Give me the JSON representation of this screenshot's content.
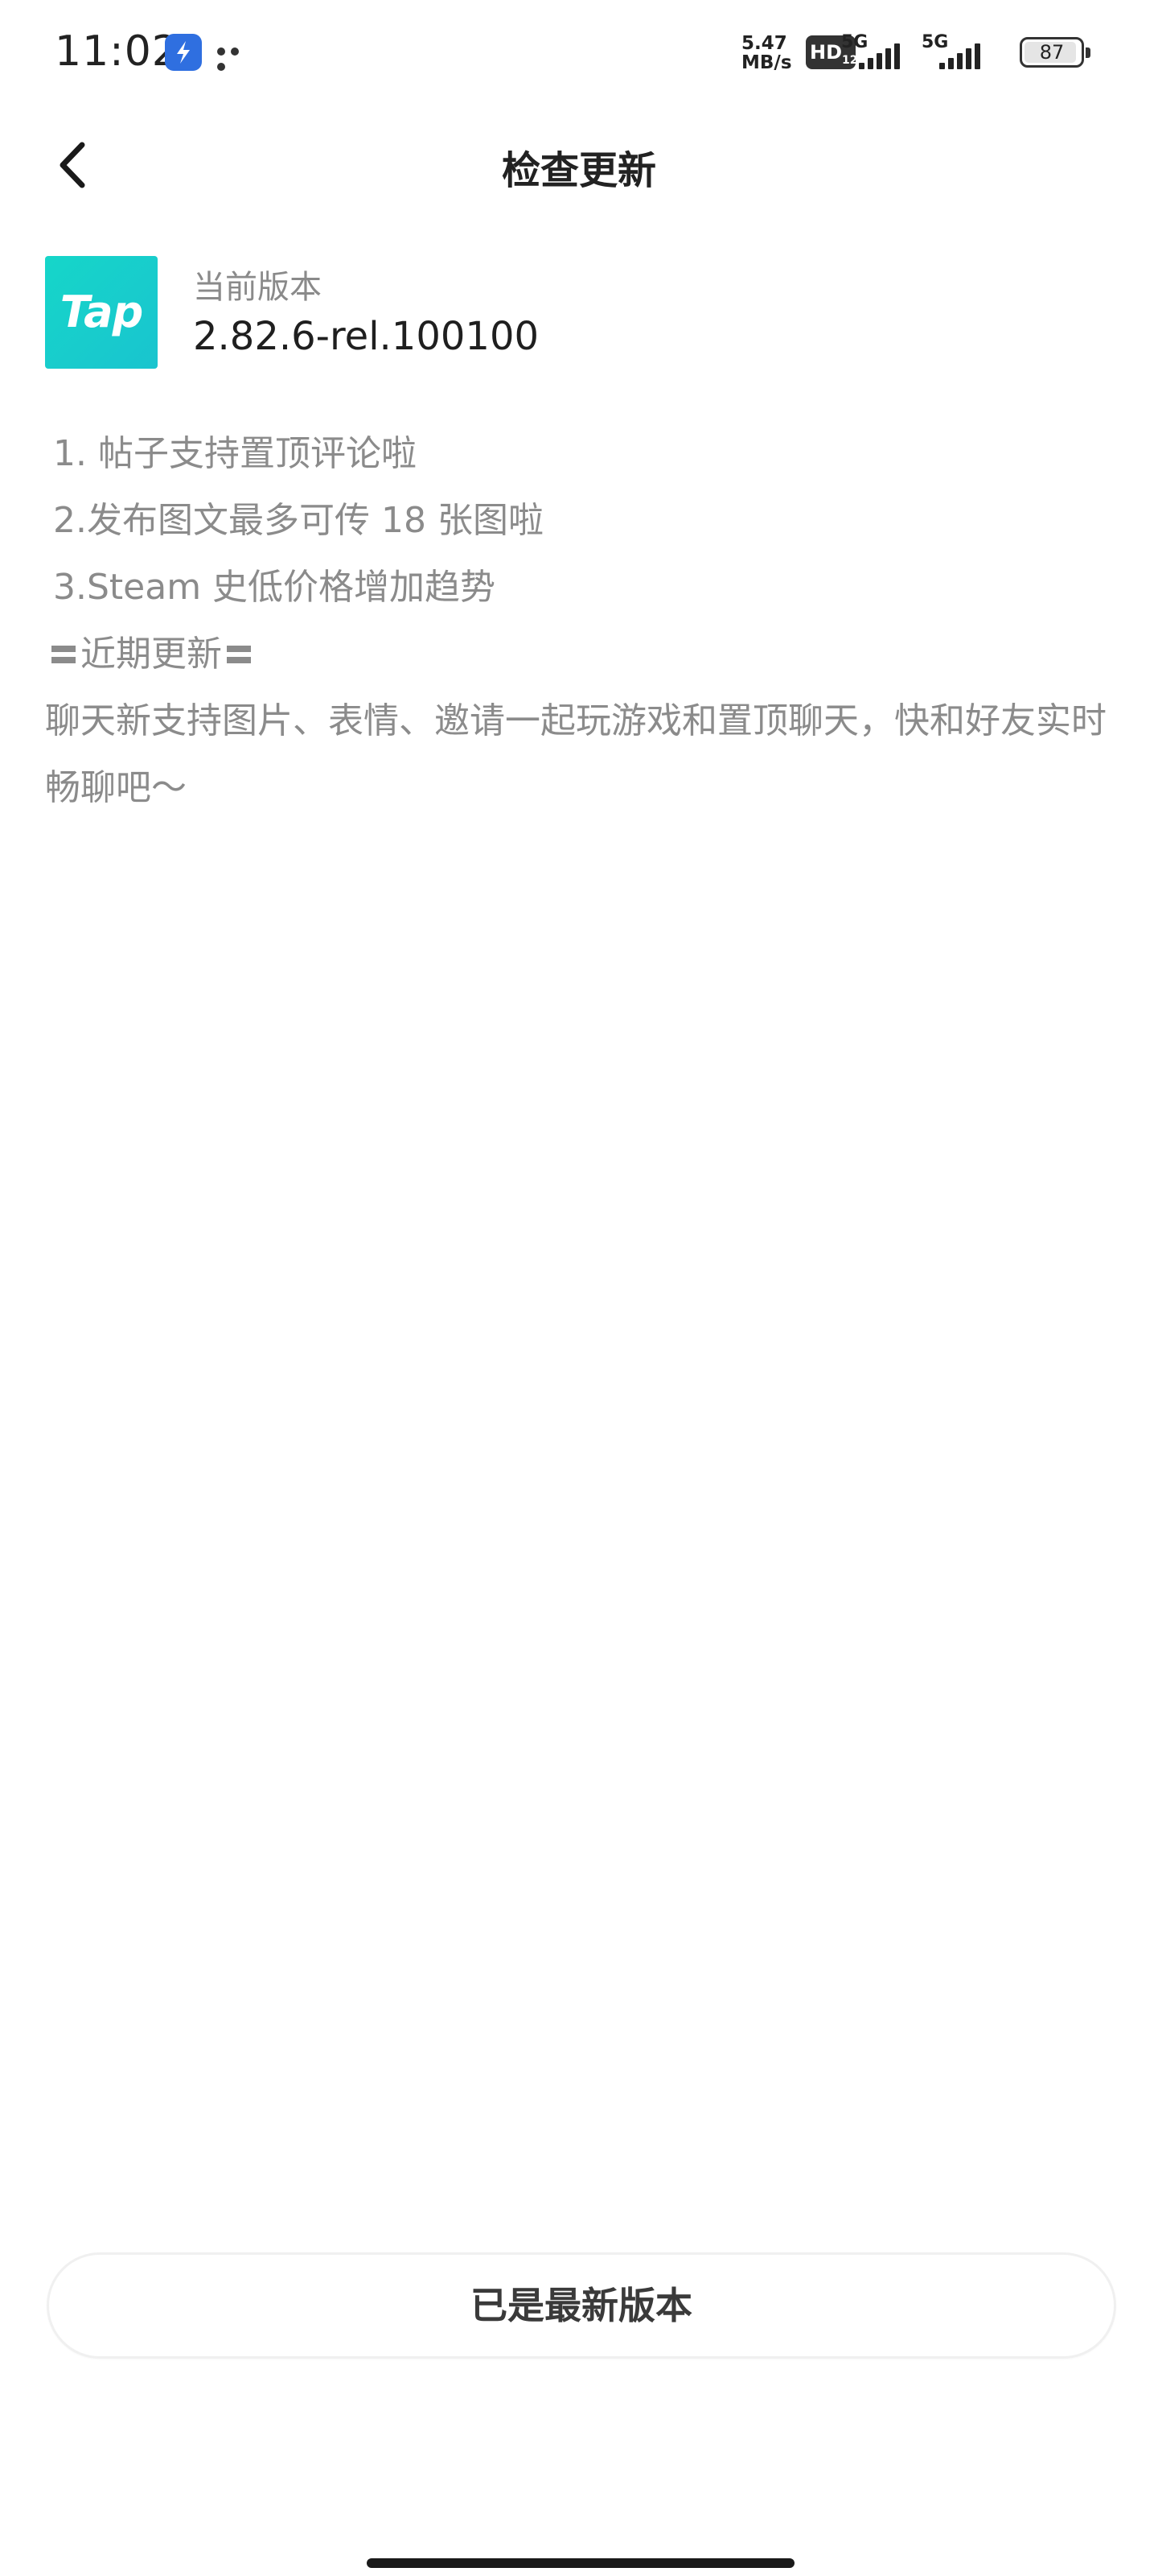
{
  "status_bar": {
    "time": "11:02",
    "net_speed_value": "5.47",
    "net_speed_unit": "MB/s",
    "hd_label": "HD",
    "hd_sub": "1",
    "hd_sub2": "2",
    "signal1_label": "5G",
    "signal2_label": "5G",
    "battery_level": "87",
    "app_icon": "blue-notification-app-icon",
    "more_icon": "more-dots-icon"
  },
  "header": {
    "title": "检查更新",
    "back_icon": "chevron-left-icon"
  },
  "app_info": {
    "logo_text": "Tap",
    "logo_color": "#16d6c9",
    "version_label": "当前版本",
    "version_value": "2.82.6-rel.100100"
  },
  "release_notes": {
    "items": [
      "1. 帖子支持置顶评论啦",
      "2.发布图文最多可传 18 张图啦",
      "3.Steam 史低价格增加趋势"
    ],
    "recent_heading": "近期更新",
    "recent_text": "聊天新支持图片、表情、邀请一起玩游戏和置顶聊天，快和好友实时畅聊吧～"
  },
  "footer": {
    "button_label": "已是最新版本"
  }
}
